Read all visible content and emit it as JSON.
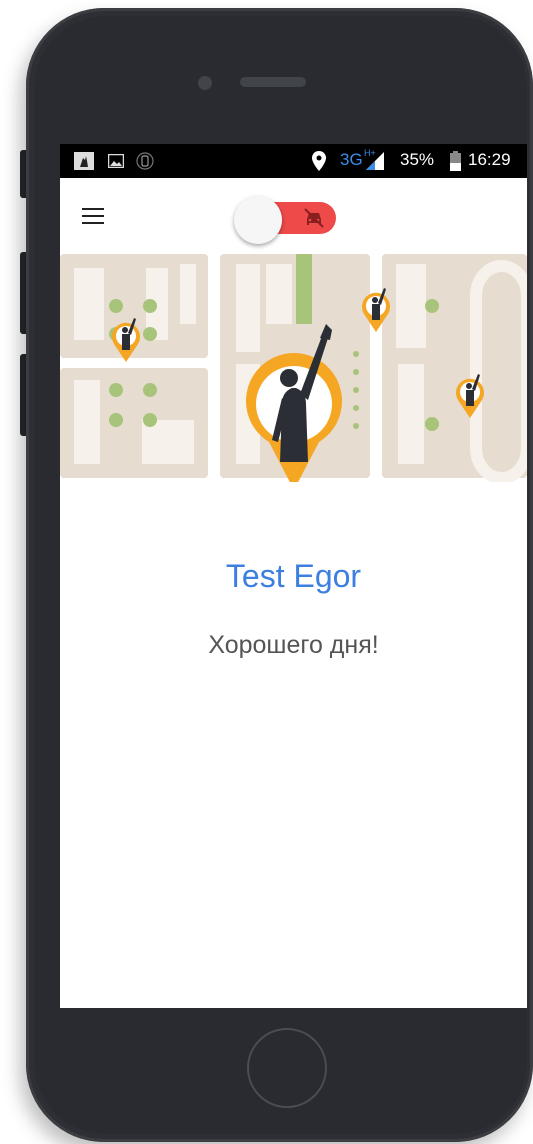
{
  "status_bar": {
    "network": "3G",
    "network_sup": "H+",
    "battery": "35%",
    "time": "16:29"
  },
  "app_bar": {
    "menu_icon": "hamburger-menu-icon",
    "toggle": {
      "state": "off",
      "icon": "no-car-icon",
      "track_color": "#ee4a4a"
    }
  },
  "hero": {
    "illustration": "map-with-people-pins"
  },
  "profile": {
    "name": "Test Egor",
    "greeting": "Хорошего дня!"
  },
  "colors": {
    "accent": "#3d7fe0",
    "pin": "#f5a623",
    "map_block": "#e6dcd0",
    "map_road": "#f6f1ea",
    "park": "#a8c47a"
  }
}
